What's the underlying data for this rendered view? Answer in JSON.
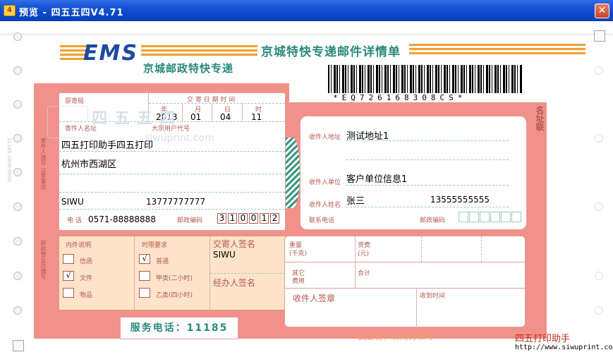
{
  "window": {
    "title": "预览 - 四五五四V4.71",
    "close_label": "✕",
    "icon_glyph": "4"
  },
  "header": {
    "ems_logo": "EMS",
    "ems_subtitle": "京城邮政特快专递",
    "form_title": "京城特快专递邮件详情单",
    "barcode_number": "*EQ726168308CS*"
  },
  "watermark": {
    "text": "四五五四",
    "url": "siwuprint.com"
  },
  "sender": {
    "label_origin": "原寄局",
    "label_send_time": "交 寄 日 期 时 间",
    "label_year": "年",
    "label_month": "月",
    "label_day": "日",
    "label_hour": "时",
    "year": "2013",
    "month": "01",
    "day": "04",
    "hour": "11",
    "label_name_address": "寄件人名址",
    "label_big_customer": "大宗用户代号",
    "company": "四五打印助手四五打印",
    "address": "杭州市西湖区",
    "name": "SIWU",
    "mobile": "13777777777",
    "label_phone": "电  话",
    "phone": "0571-88888888",
    "label_zip": "邮政编码",
    "zip": [
      "3",
      "1",
      "0",
      "0",
      "1",
      "2"
    ]
  },
  "receiver": {
    "label_address": "收件人地址",
    "address": "测试地址1",
    "label_unit": "收件人单位",
    "unit": "客户单位信息1",
    "label_name": "收件人姓名",
    "name": "张三",
    "phone": "13555555555",
    "label_phone": "联系电话",
    "label_zip": "邮政编码"
  },
  "item_type": {
    "header": "内件说明",
    "options": [
      {
        "label": "信函",
        "checked": false
      },
      {
        "label": "文件",
        "checked": true
      },
      {
        "label": "物品",
        "checked": false
      }
    ]
  },
  "time_limit": {
    "header": "时限要求",
    "options": [
      {
        "label": "普通",
        "checked": true
      },
      {
        "label": "甲类(二小时)",
        "checked": false
      },
      {
        "label": "乙类(四小时)",
        "checked": false
      }
    ]
  },
  "signatures": {
    "sender_sign_label": "交寄人签名",
    "sender_sign": "SIWU",
    "handler_sign_label": "经办人签名",
    "receiver_sign_label": "收件人签章",
    "receive_time_label": "收到时间"
  },
  "fees": {
    "weight_label": "重量",
    "weight_unit": "(千克)",
    "postage_label": "资费",
    "postage_unit": "(元)",
    "other_label": "其它",
    "other_label2": "费用",
    "total_label": "合计"
  },
  "footer": {
    "service_phone": "服务电话：11185",
    "note": "一式五份，请用力填写",
    "brand_name": "四五打印助手",
    "brand_url": "http://www.siwuprint.co"
  },
  "side": {
    "left_vertical": "寄件人填写 注意事项",
    "left_vertical2": "邮政营业员填写",
    "left_tiny": "11185-1000-0000",
    "right_vertical": "名址联"
  },
  "marks": {
    "check": "√"
  },
  "colors": {
    "titlebar": "#0a47c8",
    "form_red": "#f2908a",
    "teal": "#2a8a7a",
    "orange_stripe": "#f0a030",
    "brand_red": "#c03020"
  }
}
